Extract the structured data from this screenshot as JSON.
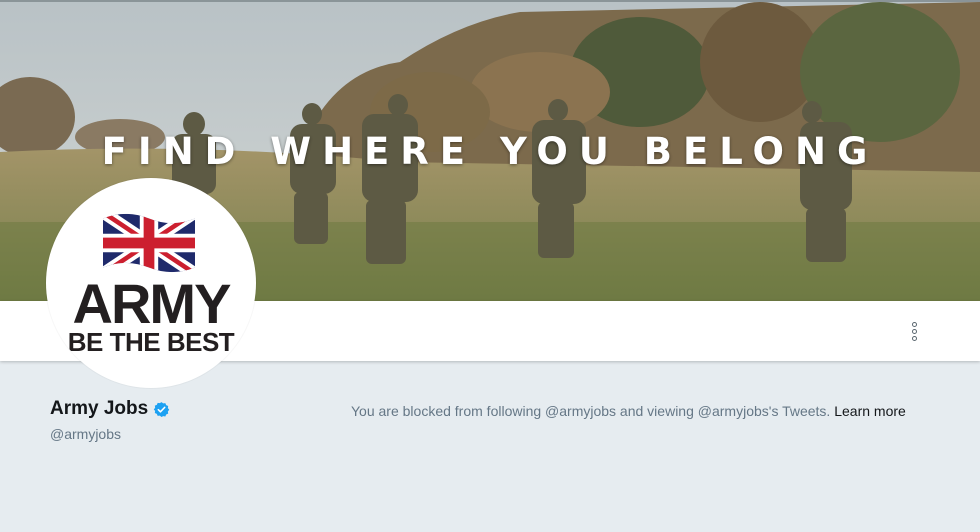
{
  "banner": {
    "tagline": "FIND WHERE YOU BELONG"
  },
  "avatar": {
    "logo_main": "ARMY",
    "logo_sub": "BE THE BEST"
  },
  "profile": {
    "name": "Army Jobs",
    "handle": "@armyjobs",
    "verified": true
  },
  "notice": {
    "message": "You are blocked from following @armyjobs and viewing @armyjobs's Tweets.",
    "link_label": "Learn more"
  },
  "icons": {
    "more": "more-vertical-icon",
    "verified": "verified-badge-icon",
    "flag": "union-jack-flag-icon"
  },
  "colors": {
    "page_background": "#e6ecf0",
    "verified_blue": "#1da1f2",
    "secondary_text": "#657786",
    "primary_text": "#14171a"
  }
}
